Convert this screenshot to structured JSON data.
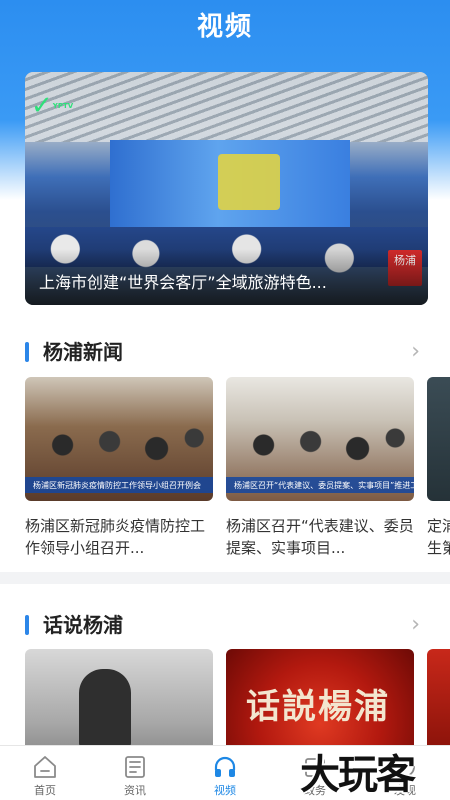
{
  "header": {
    "title": "视频"
  },
  "hero": {
    "caption": "上海市创建“世界会客厅”全域旅游特色...",
    "logo_text": "YPTV",
    "badge_text": "杨浦"
  },
  "sections": [
    {
      "title": "杨浦新闻",
      "chevron": "›",
      "items": [
        {
          "title": "杨浦区新冠肺炎疫情防控工作领导小组召开...",
          "strip_text": "杨浦区新冠肺炎疫情防控工作领导小组召开例会"
        },
        {
          "title": "杨浦区召开“代表建议、委员提案、实事项目...",
          "strip_text": "杨浦区召开“代表建议、委员提案、实事项目”推进工作推进会"
        },
        {
          "title": "定浦生第"
        }
      ]
    },
    {
      "title": "话说杨浦",
      "chevron": "›",
      "items": [
        {
          "title": ""
        },
        {
          "title": "",
          "calligraphy": "话説楊浦"
        },
        {
          "title": ""
        }
      ]
    }
  ],
  "tabbar": [
    {
      "label": "首页",
      "icon": "home-icon"
    },
    {
      "label": "资讯",
      "icon": "news-icon"
    },
    {
      "label": "视频",
      "icon": "headphones-icon",
      "active": true
    },
    {
      "label": "政务",
      "icon": "government-icon"
    },
    {
      "label": "发现",
      "icon": "discover-icon"
    }
  ],
  "watermark": "大玩客",
  "colors": {
    "accent": "#1e88e5",
    "header": "#2c8ef0"
  }
}
